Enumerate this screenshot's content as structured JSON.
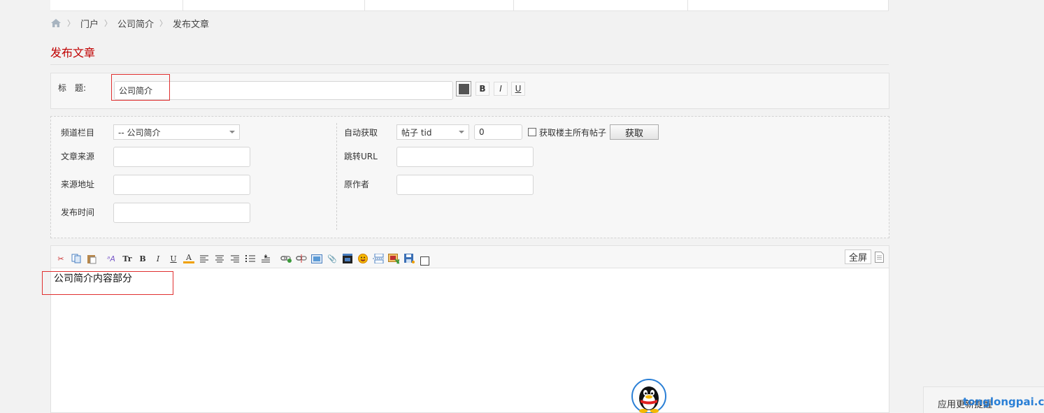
{
  "breadcrumb": {
    "items": [
      "门户",
      "公司简介",
      "发布文章"
    ]
  },
  "page_title": "发布文章",
  "title_row": {
    "label": "标　题:",
    "value": "公司简介",
    "bold_label": "B",
    "italic_label": "I",
    "underline_label": "U",
    "color_value": "#555555"
  },
  "meta": {
    "channel_label": "频道栏目",
    "channel_value": "-- 公司简介",
    "source_label": "文章来源",
    "source_value": "",
    "source_url_label": "来源地址",
    "source_url_value": "",
    "publish_time_label": "发布时间",
    "publish_time_value": "",
    "auto_fetch_label": "自动获取",
    "auto_fetch_type": "帖子 tid",
    "auto_fetch_value": "0",
    "fetch_all_label": "获取楼主所有帖子",
    "fetch_button": "获取",
    "redirect_label": "跳转URL",
    "redirect_value": "",
    "author_label": "原作者",
    "author_value": ""
  },
  "editor": {
    "fullscreen_label": "全屏",
    "content": "公司简介内容部分",
    "toolbar_icons": [
      "cut-icon",
      "copy-icon",
      "paste-icon",
      "font-family-icon",
      "font-size-icon",
      "bold-icon",
      "italic-icon",
      "underline-icon",
      "font-color-icon",
      "align-left-icon",
      "align-center-icon",
      "align-right-icon",
      "ordered-list-icon",
      "indent-icon",
      "link-icon",
      "unlink-icon",
      "image-icon",
      "attachment-icon",
      "video-icon",
      "emoji-icon",
      "page-break-icon",
      "insert-image-icon",
      "save-icon",
      "checkbox-icon",
      "source-icon"
    ]
  },
  "update_tab": {
    "label": "应用更新提醒"
  },
  "watermark": "tonglongpai.com",
  "colors": {
    "accent_red": "#c00000",
    "link_blue": "#2b6aa3"
  }
}
